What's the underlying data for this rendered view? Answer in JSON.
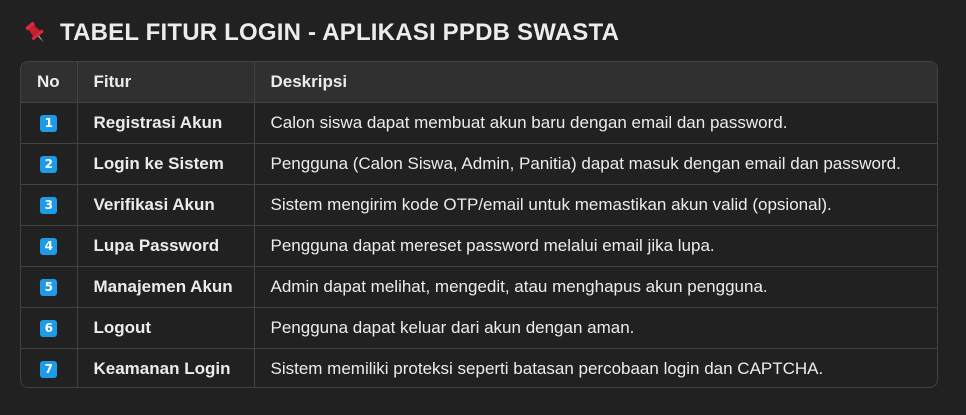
{
  "heading": {
    "icon": "pushpin-icon",
    "title": "TABEL FITUR LOGIN - APLIKASI PPDB SWASTA"
  },
  "colors": {
    "background": "#212121",
    "header_row": "#303030",
    "border": "#424242",
    "badge": "#1e9be8",
    "pin": "#e0263a"
  },
  "table": {
    "headers": [
      "No",
      "Fitur",
      "Deskripsi"
    ],
    "rows": [
      {
        "no": "1",
        "fitur": "Registrasi Akun",
        "deskripsi": "Calon siswa dapat membuat akun baru dengan email dan password."
      },
      {
        "no": "2",
        "fitur": "Login ke Sistem",
        "deskripsi": "Pengguna (Calon Siswa, Admin, Panitia) dapat masuk dengan email dan password."
      },
      {
        "no": "3",
        "fitur": "Verifikasi Akun",
        "deskripsi": "Sistem mengirim kode OTP/email untuk memastikan akun valid (opsional)."
      },
      {
        "no": "4",
        "fitur": "Lupa Password",
        "deskripsi": "Pengguna dapat mereset password melalui email jika lupa."
      },
      {
        "no": "5",
        "fitur": "Manajemen Akun",
        "deskripsi": "Admin dapat melihat, mengedit, atau menghapus akun pengguna."
      },
      {
        "no": "6",
        "fitur": "Logout",
        "deskripsi": "Pengguna dapat keluar dari akun dengan aman."
      },
      {
        "no": "7",
        "fitur": "Keamanan Login",
        "deskripsi": "Sistem memiliki proteksi seperti batasan percobaan login dan CAPTCHA."
      }
    ]
  }
}
